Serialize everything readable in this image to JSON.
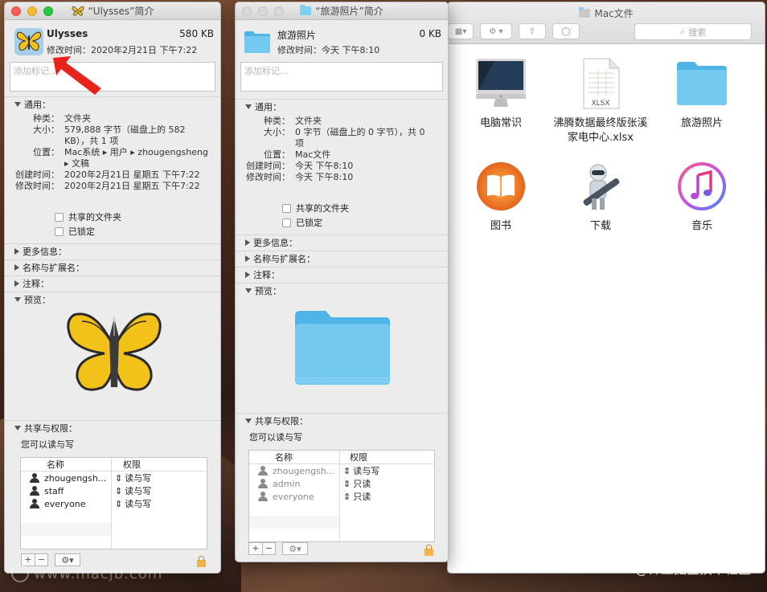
{
  "finder": {
    "title": "Mac文件",
    "search_placeholder": "搜索",
    "items": [
      {
        "label": "电脑常识",
        "icon": "imac-icon"
      },
      {
        "label": "沸腾数据最终版张溪家电中心.xlsx",
        "icon": "xlsx-file-icon",
        "file_tag": "XLSX"
      },
      {
        "label": "旅游照片",
        "icon": "folder-icon"
      },
      {
        "label": "图书",
        "icon": "books-app-icon"
      },
      {
        "label": "下载",
        "icon": "automator-icon"
      },
      {
        "label": "音乐",
        "icon": "music-app-icon"
      }
    ]
  },
  "info1": {
    "window_title": "“Ulysses”简介",
    "name": "Ulysses",
    "size": "580 KB",
    "modified": "修改时间：2020年2月21日 下午7:22",
    "tags_placeholder": "添加标记...",
    "general_header": "通用：",
    "general": [
      {
        "k": "种类：",
        "v": "文件夹"
      },
      {
        "k": "大小：",
        "v": "579,888 字节（磁盘上的 582 KB），共 1 项"
      },
      {
        "k": "位置：",
        "v": "Mac系统 ▸ 用户 ▸ zhougengsheng ▸ 文稿"
      },
      {
        "k": "创建时间：",
        "v": "2020年2月21日 星期五 下午7:22"
      },
      {
        "k": "修改时间：",
        "v": "2020年2月21日 星期五 下午7:22"
      }
    ],
    "shared_folder": "共享的文件夹",
    "locked": "已锁定",
    "more_info": "更多信息：",
    "name_ext": "名称与扩展名：",
    "comments": "注释：",
    "preview": "预览：",
    "sharing_header": "共享与权限：",
    "access_note": "您可以读与写",
    "col_name": "名称",
    "col_priv": "权限",
    "perms": [
      {
        "name": "zhougengsh...",
        "priv": "读与写",
        "icon": "user-icon"
      },
      {
        "name": "staff",
        "priv": "读与写",
        "icon": "group-icon"
      },
      {
        "name": "everyone",
        "priv": "读与写",
        "icon": "everyone-icon"
      }
    ]
  },
  "info2": {
    "window_title": "“旅游照片”简介",
    "name": "旅游照片",
    "size": "0 KB",
    "modified": "修改时间：今天 下午8:10",
    "tags_placeholder": "添加标记...",
    "general_header": "通用：",
    "general": [
      {
        "k": "种类：",
        "v": "文件夹"
      },
      {
        "k": "大小：",
        "v": "0 字节（磁盘上的 0 字节），共 0 项"
      },
      {
        "k": "位置：",
        "v": "Mac文件"
      },
      {
        "k": "创建时间：",
        "v": "今天 下午8:10"
      },
      {
        "k": "修改时间：",
        "v": "今天 下午8:10"
      }
    ],
    "shared_folder": "共享的文件夹",
    "locked": "已锁定",
    "more_info": "更多信息：",
    "name_ext": "名称与扩展名：",
    "comments": "注释：",
    "preview": "预览：",
    "sharing_header": "共享与权限：",
    "access_note": "您可以读与写",
    "col_name": "名称",
    "col_priv": "权限",
    "perms": [
      {
        "name": "zhougengsh...",
        "priv": "读与写",
        "icon": "user-icon"
      },
      {
        "name": "admin",
        "priv": "只读",
        "icon": "group-icon"
      },
      {
        "name": "everyone",
        "priv": "只读",
        "icon": "everyone-icon"
      }
    ]
  },
  "watermark_left": "www.macjb.com",
  "watermark_right": "@稀土掘金技术社区",
  "colors": {
    "folder": "#6cc4ef",
    "arrow": "#e8231c",
    "butterfly_yellow": "#f2c21b"
  }
}
